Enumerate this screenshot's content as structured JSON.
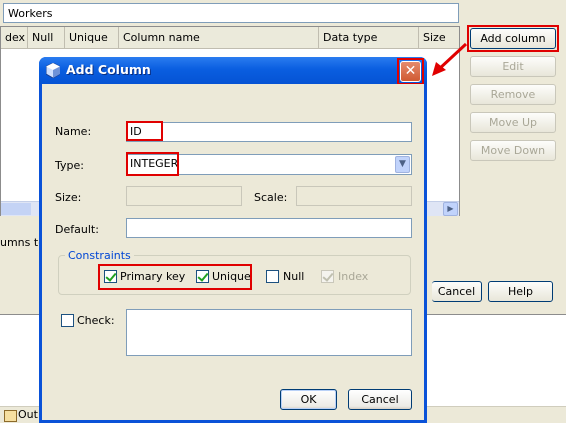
{
  "background": {
    "table_name": "Workers",
    "columns": [
      "dex",
      "Null",
      "Unique",
      "Column name",
      "Data type",
      "Size"
    ],
    "buttons": {
      "add_column": "Add column",
      "edit": "Edit",
      "remove": "Remove",
      "move_up": "Move Up",
      "move_down": "Move Down",
      "cancel": "Cancel",
      "help": "Help"
    },
    "partial_label": "umns to",
    "output_tab": "Out"
  },
  "dialog": {
    "title": "Add Column",
    "close_glyph": "✕",
    "fields": {
      "name_label": "Name:",
      "name_value": "ID",
      "type_label": "Type:",
      "type_value": "INTEGER",
      "size_label": "Size:",
      "size_value": "",
      "scale_label": "Scale:",
      "scale_value": "",
      "default_label": "Default:",
      "default_value": ""
    },
    "constraints": {
      "legend": "Constraints",
      "primary_key": {
        "label": "Primary key",
        "checked": true
      },
      "unique": {
        "label": "Unique",
        "checked": true
      },
      "null": {
        "label": "Null",
        "checked": false
      },
      "index": {
        "label": "Index",
        "checked": true,
        "disabled": true
      }
    },
    "check": {
      "label": "Check:",
      "checked": false,
      "value": ""
    },
    "buttons": {
      "ok": "OK",
      "cancel": "Cancel"
    }
  }
}
